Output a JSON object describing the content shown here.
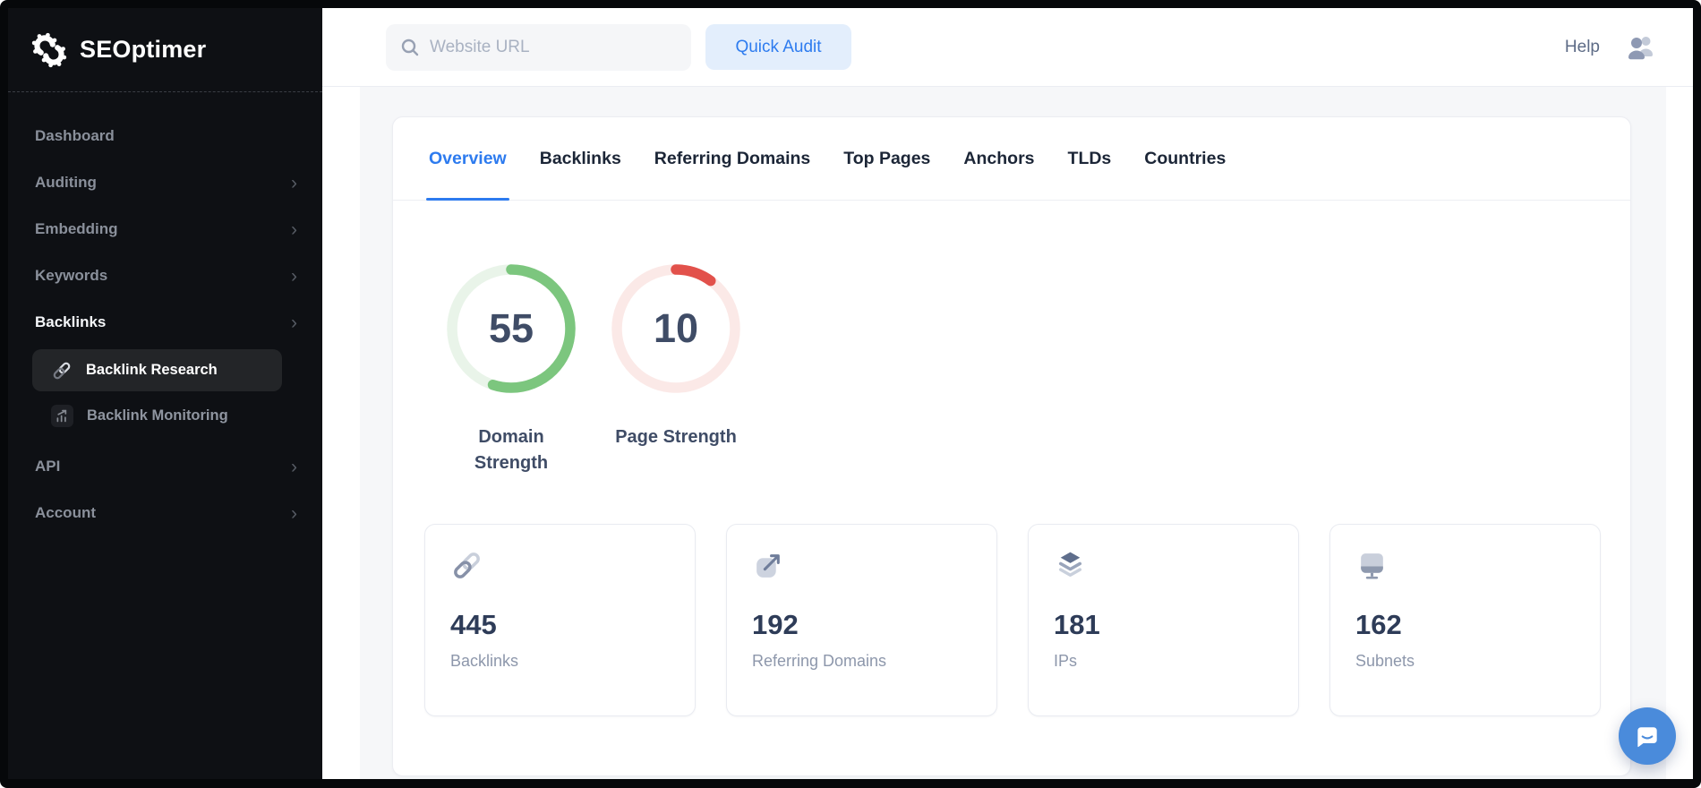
{
  "brand": {
    "name": "SEOptimer"
  },
  "topbar": {
    "search_placeholder": "Website URL",
    "quick_audit_label": "Quick Audit",
    "help_label": "Help"
  },
  "icons": {
    "chevron_right": "›"
  },
  "sidebar": {
    "items": [
      {
        "label": "Dashboard",
        "chevron": ""
      },
      {
        "label": "Auditing",
        "chevron": "›"
      },
      {
        "label": "Embedding",
        "chevron": "›"
      },
      {
        "label": "Keywords",
        "chevron": "›"
      },
      {
        "label": "Backlinks",
        "chevron": "›"
      }
    ],
    "sub_items": [
      {
        "label": "Backlink Research",
        "icon": "link-icon",
        "active": true
      },
      {
        "label": "Backlink Monitoring",
        "icon": "chart-growth-icon",
        "active": false
      }
    ],
    "items_lower": [
      {
        "label": "API",
        "chevron": "›"
      },
      {
        "label": "Account",
        "chevron": "›"
      }
    ]
  },
  "tabs": {
    "active": "Overview",
    "items": [
      "Overview",
      "Backlinks",
      "Referring Domains",
      "Top Pages",
      "Anchors",
      "TLDs",
      "Countries"
    ]
  },
  "gauges": [
    {
      "value": 55,
      "max": 100,
      "label": "Domain Strength",
      "color": "#7cc67e",
      "track_color": "#e9f4e9"
    },
    {
      "value": 10,
      "max": 100,
      "label": "Page Strength",
      "color": "#e2514b",
      "track_color": "#fbe9e7"
    }
  ],
  "stats": [
    {
      "icon": "link-icon",
      "value": "445",
      "label": "Backlinks"
    },
    {
      "icon": "external-link-icon",
      "value": "192",
      "label": "Referring Domains"
    },
    {
      "icon": "layers-icon",
      "value": "181",
      "label": "IPs"
    },
    {
      "icon": "monitor-icon",
      "value": "162",
      "label": "Subnets"
    }
  ],
  "colors": {
    "accent_blue": "#2d7bef",
    "quick_audit_bg": "#e3eefc",
    "sidebar_bg": "#0e1014",
    "panel_bg": "#ffffff",
    "content_bg": "#f6f7f9",
    "green": "#7cc67e",
    "red": "#e2514b",
    "chat_blue": "#4a8bdb"
  }
}
